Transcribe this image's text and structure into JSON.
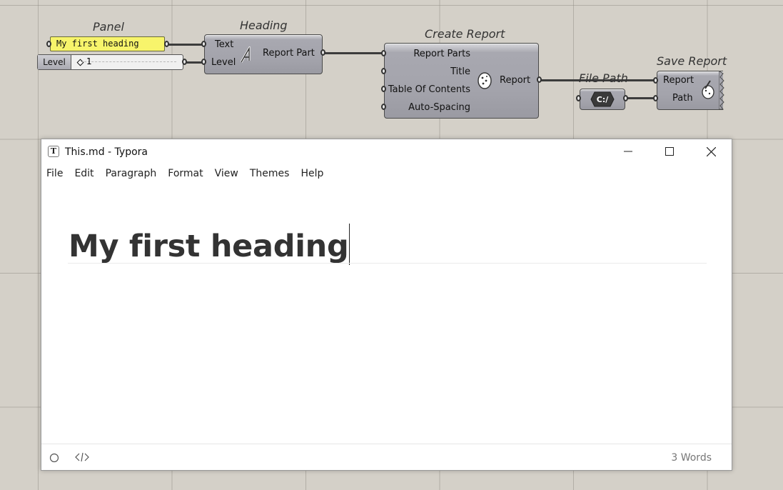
{
  "canvas": {
    "nodes": {
      "panel": {
        "title": "Panel",
        "content": "My first heading"
      },
      "level_slider": {
        "label": "Level",
        "value": "1"
      },
      "heading": {
        "title": "Heading",
        "inputs": [
          "Text",
          "Level"
        ],
        "output": "Report Part"
      },
      "create_report": {
        "title": "Create Report",
        "inputs": [
          "Report Parts",
          "Title",
          "Table Of Contents",
          "Auto-Spacing"
        ],
        "output": "Report"
      },
      "file_path": {
        "title": "File Path",
        "icon_text": "C:/"
      },
      "save_report": {
        "title": "Save Report",
        "inputs": [
          "Report",
          "Path"
        ]
      }
    }
  },
  "window": {
    "title": "This.md - Typora",
    "app_icon": "T",
    "controls": [
      "minimize-icon",
      "maximize-icon",
      "close-icon"
    ],
    "menu": [
      "File",
      "Edit",
      "Paragraph",
      "Format",
      "View",
      "Themes",
      "Help"
    ],
    "document": {
      "heading": "My first heading"
    },
    "status": {
      "word_count": "3 Words"
    }
  },
  "colors": {
    "panel_yellow": "#f7f46b",
    "canvas_bg": "#d4d0c8",
    "component_gray": "#a4a4ac"
  }
}
